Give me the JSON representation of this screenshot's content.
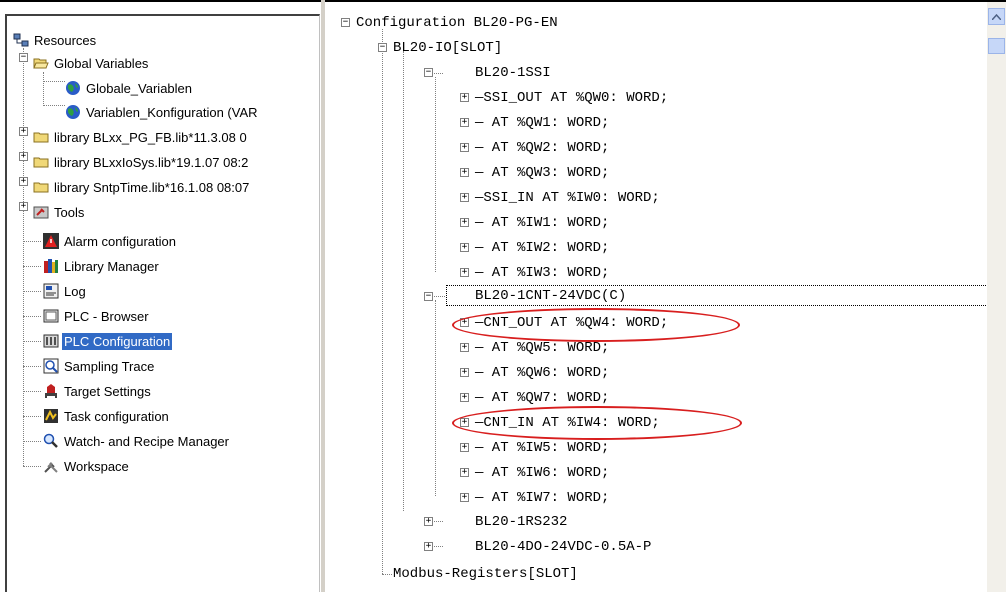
{
  "resources_tree": {
    "root": "Resources",
    "items": [
      {
        "label": "Global Variables",
        "icon": "folder-open-icon"
      },
      {
        "label": "Globale_Variablen",
        "icon": "globe-icon"
      },
      {
        "label": "Variablen_Konfiguration (VAR",
        "icon": "globe-icon"
      },
      {
        "label": "library BLxx_PG_FB.lib*11.3.08 0",
        "icon": "folder-icon"
      },
      {
        "label": "library BLxxIoSys.lib*19.1.07 08:2",
        "icon": "folder-icon"
      },
      {
        "label": "library SntpTime.lib*16.1.08 08:07",
        "icon": "folder-icon"
      },
      {
        "label": "Tools",
        "icon": "tools-icon"
      },
      {
        "label": "Alarm configuration",
        "icon": "alarm-icon"
      },
      {
        "label": "Library Manager",
        "icon": "books-icon"
      },
      {
        "label": "Log",
        "icon": "log-icon"
      },
      {
        "label": "PLC - Browser",
        "icon": "browser-icon"
      },
      {
        "label": "PLC Configuration",
        "icon": "plc-config-icon"
      },
      {
        "label": "Sampling Trace",
        "icon": "trace-icon"
      },
      {
        "label": "Target Settings",
        "icon": "target-icon"
      },
      {
        "label": "Task configuration",
        "icon": "task-icon"
      },
      {
        "label": "Watch- and Recipe Manager",
        "icon": "magnifier-icon"
      },
      {
        "label": "Workspace",
        "icon": "workspace-icon"
      }
    ],
    "selected": "PLC Configuration"
  },
  "config_tree": {
    "root": "Configuration BL20-PG-EN",
    "slot": "BL20-IO[SLOT]",
    "modules": [
      {
        "name": "BL20-1SSI"
      },
      {
        "name": "BL20-1CNT-24VDC(C)"
      },
      {
        "name": "BL20-1RS232"
      },
      {
        "name": "BL20-4DO-24VDC-0.5A-P"
      }
    ],
    "ssi_rows": [
      "SSI_OUT AT %QW0: WORD;",
      " AT %QW1: WORD;",
      " AT %QW2: WORD;",
      " AT %QW3: WORD;",
      "SSI_IN AT %IW0: WORD;",
      " AT %IW1: WORD;",
      " AT %IW2: WORD;",
      " AT %IW3: WORD;"
    ],
    "cnt_rows": [
      "CNT_OUT AT %QW4: WORD;",
      " AT %QW5: WORD;",
      " AT %QW6: WORD;",
      " AT %QW7: WORD;",
      "CNT_IN AT %IW4: WORD;",
      " AT %IW5: WORD;",
      " AT %IW6: WORD;",
      " AT %IW7: WORD;"
    ],
    "modbus": "Modbus-Registers[SLOT]"
  },
  "colors": {
    "selection": "#316ac5",
    "highlight_ellipse": "#d81e1e"
  }
}
